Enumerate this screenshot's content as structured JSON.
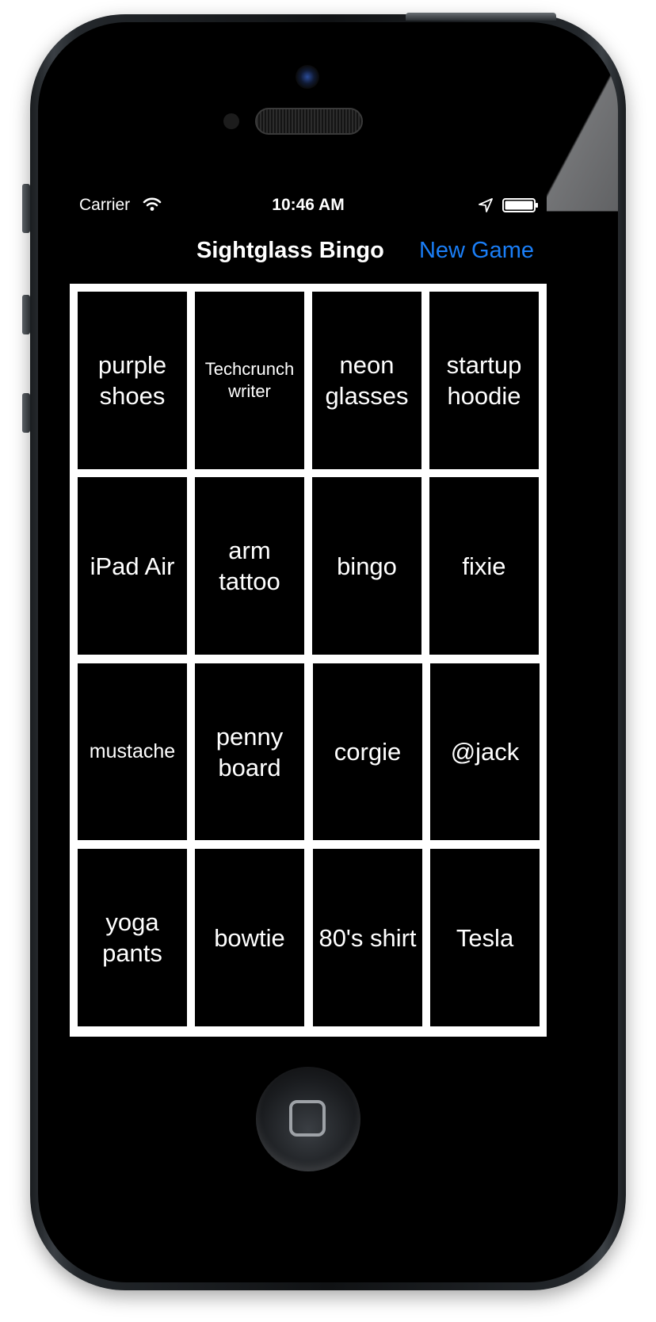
{
  "status_bar": {
    "carrier": "Carrier",
    "time": "10:46 AM",
    "icons": [
      "wifi-icon",
      "location-arrow-icon",
      "battery-icon"
    ]
  },
  "nav_bar": {
    "title": "Sightglass Bingo",
    "new_game_label": "New Game",
    "accent_color": "#1a7ef7"
  },
  "board": {
    "rows": [
      [
        "purple shoes",
        "Techcrunch writer",
        "neon glasses",
        "startup hoodie"
      ],
      [
        "iPad Air",
        "arm tattoo",
        "bingo",
        "fixie"
      ],
      [
        "mustache",
        "penny board",
        "corgie",
        "@jack"
      ],
      [
        "yoga pants",
        "bowtie",
        "80's shirt",
        "Tesla"
      ]
    ]
  },
  "colors": {
    "tile_background": "#000000",
    "tile_text": "#ffffff",
    "board_background": "#ffffff"
  }
}
